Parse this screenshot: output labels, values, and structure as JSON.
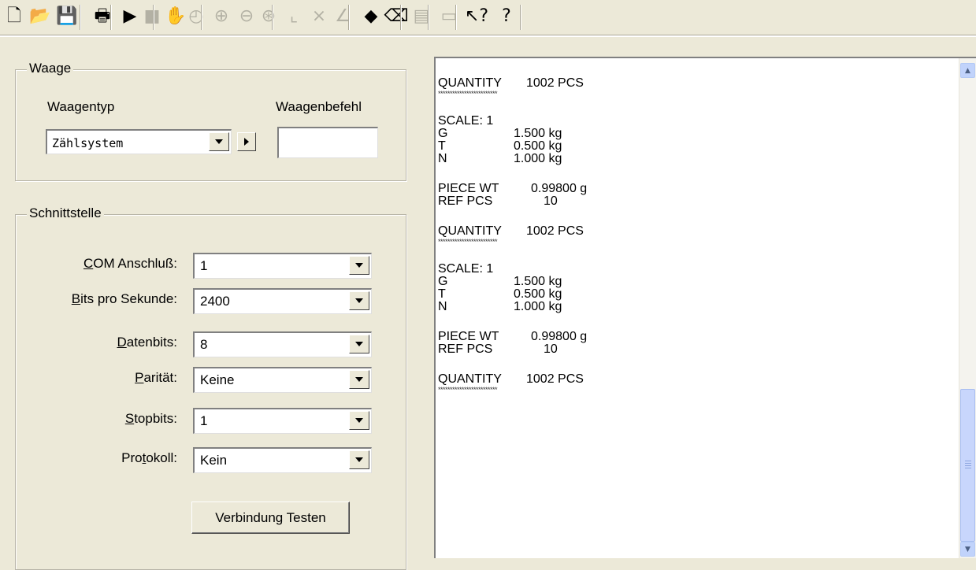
{
  "toolbar": {
    "buttons": [
      {
        "name": "new-file-icon",
        "glyph": "🗋",
        "enabled": true
      },
      {
        "name": "open-folder-icon",
        "glyph": "📂",
        "enabled": true
      },
      {
        "name": "save-icon",
        "glyph": "💾",
        "enabled": true
      },
      {
        "name": "print-icon",
        "glyph": "🖶",
        "enabled": true
      },
      {
        "name": "play-icon",
        "glyph": "▶",
        "enabled": true
      },
      {
        "name": "stop-icon",
        "glyph": "■",
        "enabled": false
      },
      {
        "name": "pan-hand-icon",
        "glyph": "✋",
        "enabled": false
      },
      {
        "name": "clock-icon",
        "glyph": "◴",
        "enabled": false
      },
      {
        "name": "zoom-in-icon",
        "glyph": "⊕",
        "enabled": false
      },
      {
        "name": "zoom-out-icon",
        "glyph": "⊖",
        "enabled": false
      },
      {
        "name": "zoom-fit-icon",
        "glyph": "⊛",
        "enabled": false
      },
      {
        "name": "line-chart-icon",
        "glyph": "⌞",
        "enabled": false
      },
      {
        "name": "cross-chart-icon",
        "glyph": "⨯",
        "enabled": false
      },
      {
        "name": "slope-chart-icon",
        "glyph": "∠",
        "enabled": false
      },
      {
        "name": "fill-bucket-icon",
        "glyph": "◆",
        "enabled": true
      },
      {
        "name": "eraser-icon",
        "glyph": "⌫",
        "enabled": true
      },
      {
        "name": "document-icon",
        "glyph": "▤",
        "enabled": false
      },
      {
        "name": "window-icon",
        "glyph": "▭",
        "enabled": false
      },
      {
        "name": "context-help-icon",
        "glyph": "↖?",
        "enabled": true
      },
      {
        "name": "help-icon",
        "glyph": "?",
        "enabled": true
      }
    ]
  },
  "waage": {
    "title": "Waage",
    "type_label": "Waagentyp",
    "command_label": "Waagenbefehl",
    "type_value": "Zählsystem",
    "command_value": ""
  },
  "schnittstelle": {
    "title": "Schnittstelle",
    "fields": [
      {
        "key": "C",
        "rest": "OM Anschluß:",
        "value": "1"
      },
      {
        "key": "B",
        "rest": "its pro Sekunde:",
        "value": "2400"
      },
      {
        "key": "D",
        "rest": "atenbits:",
        "value": "8"
      },
      {
        "key": "P",
        "rest": "arität:",
        "value": "Keine"
      },
      {
        "key": "S",
        "rest": "topbits:",
        "value": "1"
      },
      {
        "pre": "Pro",
        "key": "t",
        "rest": "okoll:",
        "value": "Kein"
      }
    ],
    "test_button": "Verbindung Testen"
  },
  "output": {
    "stars": "*************************",
    "blocks": [
      {
        "type": "qty",
        "label": "QUANTITY",
        "value": "1002 PCS"
      },
      {
        "type": "scale",
        "title": "SCALE: 1",
        "rows": [
          [
            "G",
            "1.500 kg"
          ],
          [
            "T",
            "0.500 kg"
          ],
          [
            "N",
            "1.000 kg"
          ]
        ]
      },
      {
        "type": "piece",
        "rows": [
          [
            "PIECE WT",
            "0.99800 g"
          ],
          [
            "REF PCS",
            "10"
          ]
        ]
      },
      {
        "type": "qty",
        "label": "QUANTITY",
        "value": "1002 PCS"
      },
      {
        "type": "scale",
        "title": "SCALE: 1",
        "rows": [
          [
            "G",
            "1.500 kg"
          ],
          [
            "T",
            "0.500 kg"
          ],
          [
            "N",
            "1.000 kg"
          ]
        ]
      },
      {
        "type": "piece",
        "rows": [
          [
            "PIECE WT",
            "0.99800 g"
          ],
          [
            "REF PCS",
            "10"
          ]
        ]
      },
      {
        "type": "qty",
        "label": "QUANTITY",
        "value": "1002 PCS"
      }
    ]
  }
}
